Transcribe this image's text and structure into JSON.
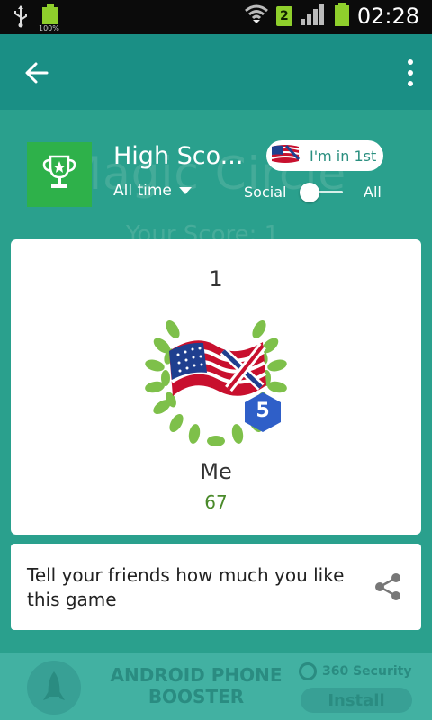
{
  "status_bar": {
    "time": "02:28",
    "sim_number": "2",
    "battery_label": "100%"
  },
  "app_bar": {
    "back_icon": "arrow-left-icon",
    "menu_icon": "more-vert-icon"
  },
  "background": {
    "game_title": "Magic Circle",
    "your_score": "Your Score: 1"
  },
  "leaderboard": {
    "title": "High Sco...",
    "time_filter": "All time",
    "rank_badge": "I'm in 1st",
    "toggle_left": "Social",
    "toggle_right": "All",
    "toggle_state": "Social"
  },
  "player_card": {
    "rank": "1",
    "level": "5",
    "name": "Me",
    "score": "67"
  },
  "share": {
    "text": "Tell your friends how much you like this game",
    "icon": "share-icon"
  },
  "ad": {
    "title": "ANDROID PHONE BOOSTER",
    "brand": "360 Security",
    "install": "Install"
  },
  "colors": {
    "app_bar": "#1a8f85",
    "background": "#2aa08d",
    "trophy_tile": "#2eb14a",
    "score_text": "#4a8a2a",
    "level_badge": "#2f5fc8"
  }
}
